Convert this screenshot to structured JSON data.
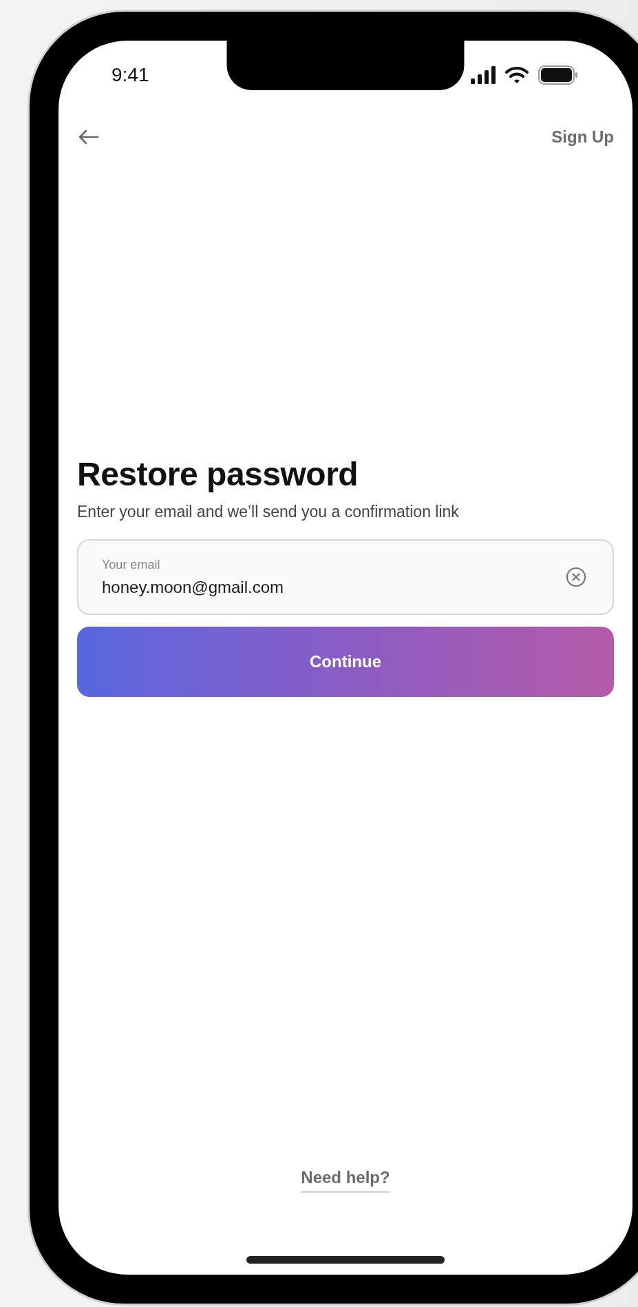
{
  "status_bar": {
    "time": "9:41"
  },
  "nav": {
    "sign_up": "Sign Up"
  },
  "title": "Restore password",
  "subtitle": "Enter your email and we’ll send you a confirmation link",
  "email_field": {
    "label": "Your email",
    "value": "honey.moon@gmail.com"
  },
  "continue_button": "Continue",
  "help_link": "Need help?"
}
